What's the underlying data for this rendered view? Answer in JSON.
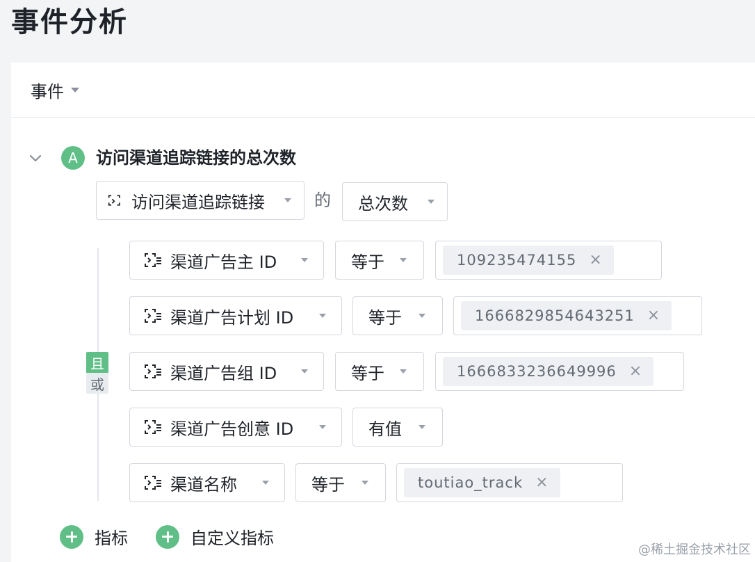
{
  "page": {
    "title": "事件分析"
  },
  "header": {
    "type_select": "事件"
  },
  "metric": {
    "badge": "A",
    "title": "访问渠道追踪链接的总次数",
    "event": "访问渠道追踪链接",
    "connector": "的",
    "aggregation": "总次数"
  },
  "logic": {
    "and_label": "且",
    "or_label": "或"
  },
  "filters": [
    {
      "property": "渠道广告主 ID",
      "operator": "等于",
      "value": "109235474155"
    },
    {
      "property": "渠道广告计划 ID",
      "operator": "等于",
      "value": "1666829854643251"
    },
    {
      "property": "渠道广告组 ID",
      "operator": "等于",
      "value": "1666833236649996"
    },
    {
      "property": "渠道广告创意 ID",
      "operator": "有值",
      "value": null
    },
    {
      "property": "渠道名称",
      "operator": "等于",
      "value": "toutiao_track"
    }
  ],
  "actions": {
    "add_metric": "指标",
    "add_custom_metric": "自定义指标"
  },
  "tag_remove_symbol": "×",
  "watermark": "@稀土掘金技术社区",
  "colors": {
    "accent": "#5fbf86",
    "border": "#d4d7dd",
    "tag_bg": "#eef0f3"
  }
}
